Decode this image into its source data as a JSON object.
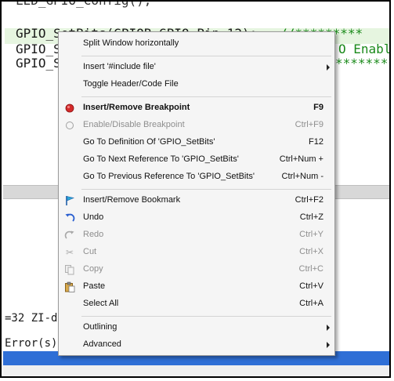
{
  "editor": {
    "line_top": "LED_GPIO_Config();",
    "line1_code": "GPIO_SetBits(GPIOB,GPIO_Pin_12);",
    "line1_comment": "//*********",
    "line2_code": "GPIO_S",
    "line2_comment": "O Enabl",
    "line3_code": "GPIO_S",
    "line3_comment": "*********"
  },
  "output": {
    "line1": "=32 ZI-da",
    "line2": "Error(s),"
  },
  "menu": {
    "split_window": "Split Window horizontally",
    "insert_include": "Insert '#include file'",
    "toggle_header": "Toggle Header/Code File",
    "insert_breakpoint": "Insert/Remove Breakpoint",
    "insert_breakpoint_shortcut": "F9",
    "enable_breakpoint": "Enable/Disable Breakpoint",
    "enable_breakpoint_shortcut": "Ctrl+F9",
    "goto_definition": "Go To Definition Of 'GPIO_SetBits'",
    "goto_definition_shortcut": "F12",
    "goto_next": "Go To Next Reference To 'GPIO_SetBits'",
    "goto_next_shortcut": "Ctrl+Num +",
    "goto_prev": "Go To Previous Reference To 'GPIO_SetBits'",
    "goto_prev_shortcut": "Ctrl+Num -",
    "bookmark": "Insert/Remove Bookmark",
    "bookmark_shortcut": "Ctrl+F2",
    "undo": "Undo",
    "undo_shortcut": "Ctrl+Z",
    "redo": "Redo",
    "redo_shortcut": "Ctrl+Y",
    "cut": "Cut",
    "cut_shortcut": "Ctrl+X",
    "copy": "Copy",
    "copy_shortcut": "Ctrl+C",
    "paste": "Paste",
    "paste_shortcut": "Ctrl+V",
    "select_all": "Select All",
    "select_all_shortcut": "Ctrl+A",
    "outlining": "Outlining",
    "advanced": "Advanced"
  },
  "colors": {
    "breakpoint_red": "#d42a2a",
    "highlight_bar": "#e6f5e0",
    "status_blue": "#2f6fd6"
  }
}
